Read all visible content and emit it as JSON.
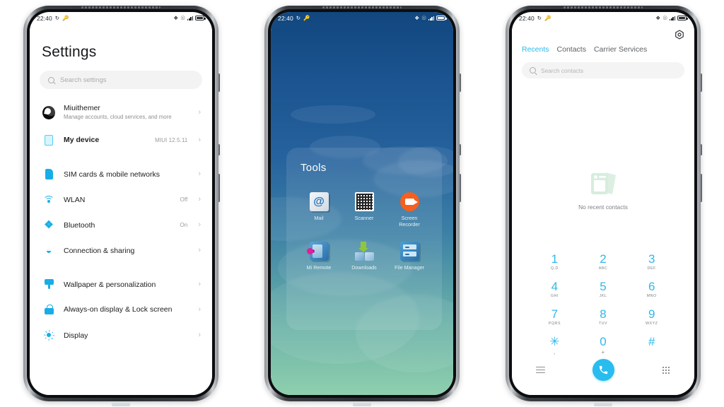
{
  "status_bar": {
    "time": "22:40",
    "left_icons": [
      "sync-icon",
      "vpn-key-icon"
    ],
    "right_icons": [
      "bluetooth-icon",
      "alarm-icon",
      "signal-bars-icon",
      "battery-icon"
    ]
  },
  "phone1_settings": {
    "screen_name": "Settings",
    "title": "Settings",
    "search": {
      "placeholder": "Search settings"
    },
    "account": {
      "name": "Miuithemer",
      "subtitle": "Manage accounts, cloud services, and more",
      "icon": "account-avatar"
    },
    "device": {
      "label": "My device",
      "value": "MIUI 12.5.11",
      "icon": "device-icon"
    },
    "items": [
      {
        "label": "SIM cards & mobile networks",
        "value": "",
        "icon": "sim-card-icon"
      },
      {
        "label": "WLAN",
        "value": "Off",
        "icon": "wifi-icon"
      },
      {
        "label": "Bluetooth",
        "value": "On",
        "icon": "bluetooth-icon"
      },
      {
        "label": "Connection & sharing",
        "value": "",
        "icon": "connection-sharing-icon"
      },
      {
        "label": "Wallpaper & personalization",
        "value": "",
        "icon": "wallpaper-icon"
      },
      {
        "label": "Always-on display & Lock screen",
        "value": "",
        "icon": "lock-icon"
      },
      {
        "label": "Display",
        "value": "",
        "icon": "brightness-icon"
      }
    ],
    "chevron": "›"
  },
  "phone2_home": {
    "screen_name": "Home screen folder",
    "folder_title": "Tools",
    "apps": [
      {
        "label": "Mail",
        "icon": "mail-app-icon"
      },
      {
        "label": "Scanner",
        "icon": "qr-scanner-app-icon"
      },
      {
        "label": "Screen Recorder",
        "icon": "screen-recorder-app-icon"
      },
      {
        "label": "Mi Remote",
        "icon": "mi-remote-app-icon"
      },
      {
        "label": "Downloads",
        "icon": "downloads-app-icon"
      },
      {
        "label": "File Manager",
        "icon": "file-manager-app-icon"
      }
    ],
    "wallpaper_colors": [
      "#12477f",
      "#26629d",
      "#69b0a8",
      "#8ecfae"
    ]
  },
  "phone3_dialer": {
    "screen_name": "Phone / Dialer",
    "settings_icon": "gear-icon",
    "tabs": [
      {
        "label": "Recents",
        "active": true
      },
      {
        "label": "Contacts",
        "active": false
      },
      {
        "label": "Carrier Services",
        "active": false
      }
    ],
    "search": {
      "placeholder": "Search contacts"
    },
    "empty_state": {
      "text": "No recent contacts",
      "icon": "contact-cards-icon"
    },
    "keypad": [
      {
        "num": "1",
        "sub": "Q,D"
      },
      {
        "num": "2",
        "sub": "ABC"
      },
      {
        "num": "3",
        "sub": "DEF"
      },
      {
        "num": "4",
        "sub": "GHI"
      },
      {
        "num": "5",
        "sub": "JKL"
      },
      {
        "num": "6",
        "sub": "MNO"
      },
      {
        "num": "7",
        "sub": "PQRS"
      },
      {
        "num": "8",
        "sub": "TUV"
      },
      {
        "num": "9",
        "sub": "WXYZ"
      },
      {
        "num": "✳",
        "sub": ","
      },
      {
        "num": "0",
        "sub": "+"
      },
      {
        "num": "#",
        "sub": ""
      }
    ],
    "bottom_bar": {
      "menu_icon": "hamburger-menu-icon",
      "call_icon": "call-button-icon",
      "keypad_icon": "keypad-icon"
    },
    "accent_color": "#2fb9e9"
  }
}
